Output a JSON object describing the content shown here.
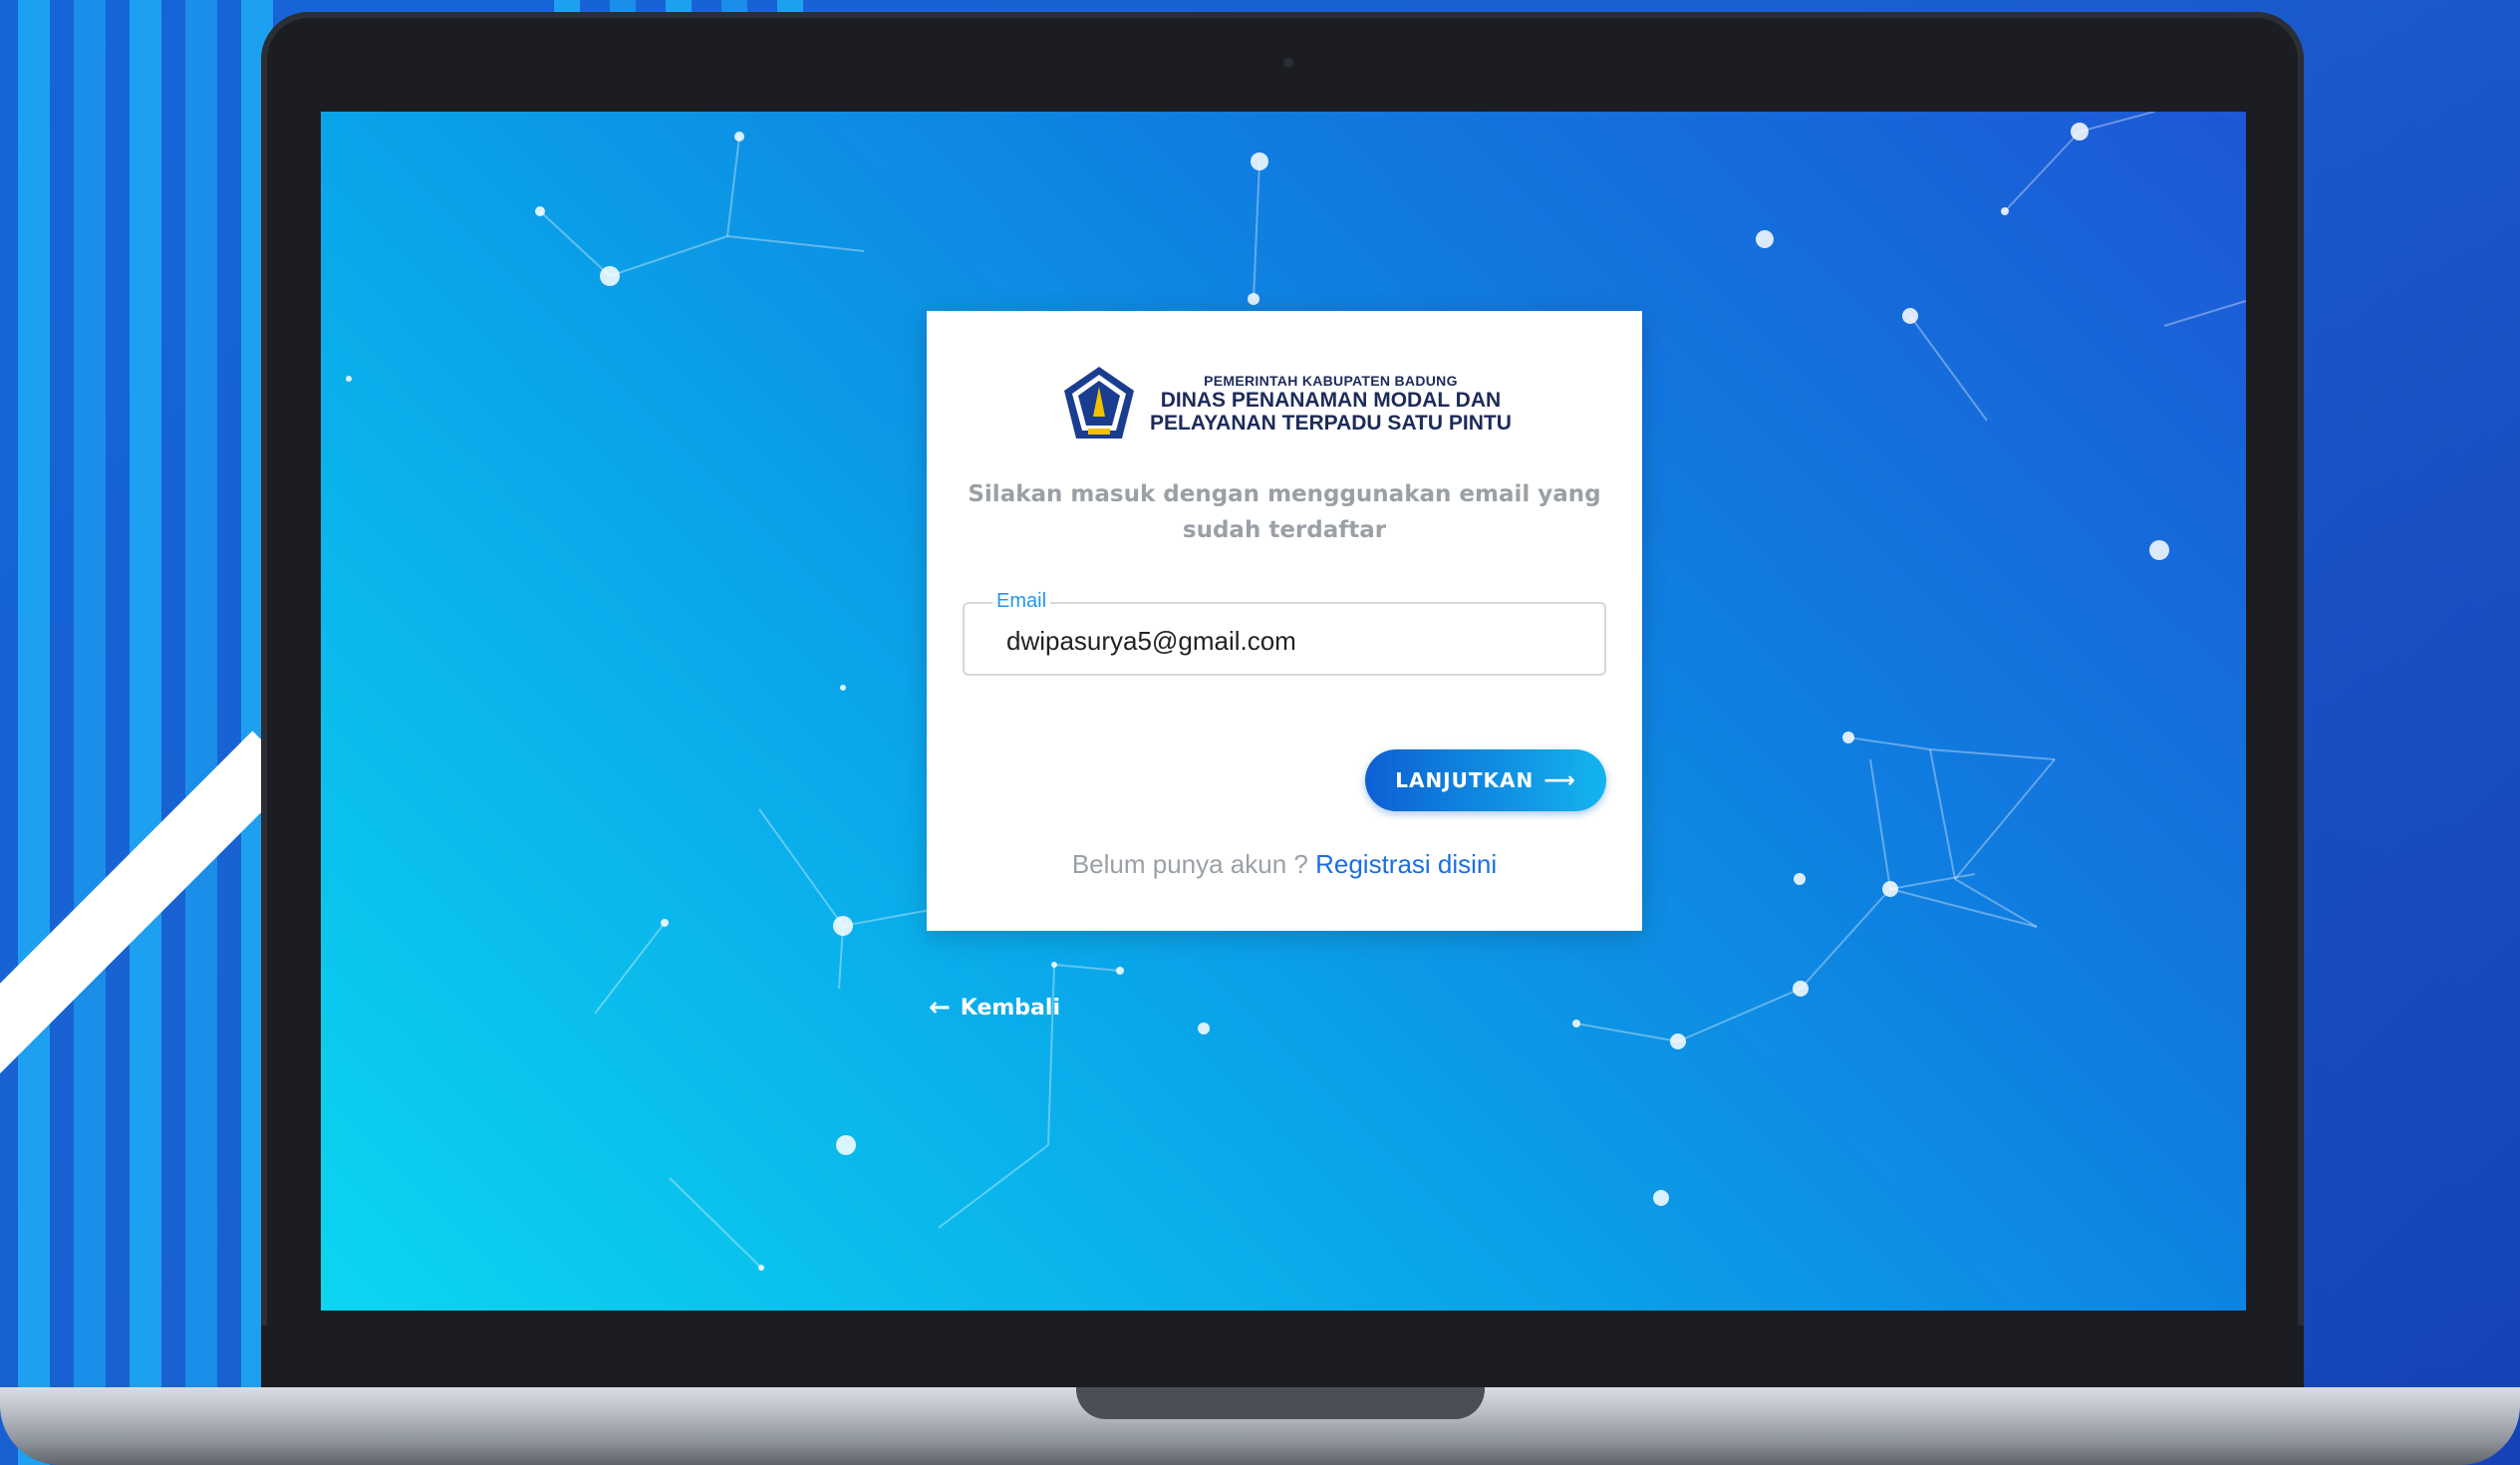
{
  "logo": {
    "line1": "PEMERINTAH KABUPATEN BADUNG",
    "line2": "DINAS PENANAMAN MODAL DAN",
    "line3": "PELAYANAN TERPADU SATU PINTU"
  },
  "login": {
    "subtitle": "Silakan masuk dengan menggunakan email yang sudah terdaftar",
    "email_label": "Email",
    "email_value": "dwipasurya5@gmail.com",
    "submit_label": "LANJUTKAN",
    "register_prompt": "Belum punya akun ?",
    "register_link": "Registrasi disini"
  },
  "nav": {
    "back_label": "Kembali"
  },
  "colors": {
    "screen_gradient_start": "#0bd6f0",
    "screen_gradient_end": "#1d57d6",
    "button_start": "#0d5fd3",
    "button_end": "#12b5ef",
    "field_label": "#2196f3",
    "link": "#1b6fe0",
    "muted_text": "#9aa0a6"
  },
  "icons": [
    "badung-crest-icon",
    "arrow-right-icon",
    "arrow-left-icon"
  ]
}
